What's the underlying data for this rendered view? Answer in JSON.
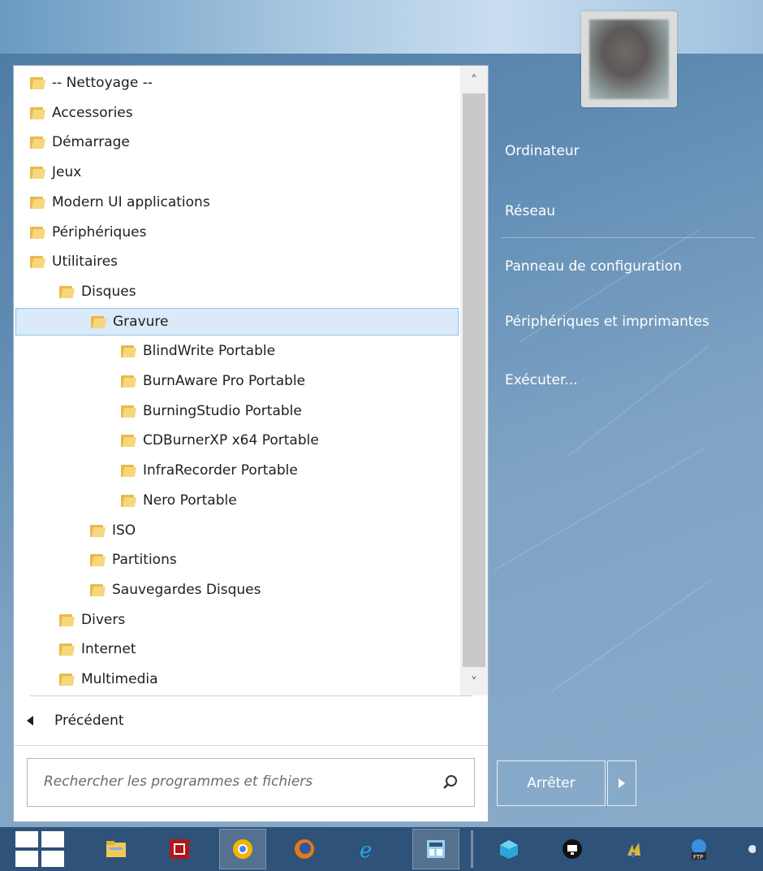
{
  "tree": {
    "items": [
      {
        "label": "-- Nettoyage --",
        "depth": 0
      },
      {
        "label": "Accessories",
        "depth": 0
      },
      {
        "label": "Démarrage",
        "depth": 0
      },
      {
        "label": "Jeux",
        "depth": 0
      },
      {
        "label": "Modern UI applications",
        "depth": 0
      },
      {
        "label": "Périphériques",
        "depth": 0
      },
      {
        "label": "Utilitaires",
        "depth": 0
      },
      {
        "label": "Disques",
        "depth": 1
      },
      {
        "label": "Gravure",
        "depth": 2,
        "selected": true
      },
      {
        "label": "BlindWrite Portable",
        "depth": 3
      },
      {
        "label": "BurnAware Pro Portable",
        "depth": 3
      },
      {
        "label": "BurningStudio Portable",
        "depth": 3
      },
      {
        "label": "CDBurnerXP x64 Portable",
        "depth": 3
      },
      {
        "label": "InfraRecorder Portable",
        "depth": 3
      },
      {
        "label": "Nero Portable",
        "depth": 3
      },
      {
        "label": "ISO",
        "depth": 2
      },
      {
        "label": "Partitions",
        "depth": 2
      },
      {
        "label": "Sauvegardes Disques",
        "depth": 2
      },
      {
        "label": "Divers",
        "depth": 1
      },
      {
        "label": "Internet",
        "depth": 1
      },
      {
        "label": "Multimedia",
        "depth": 1
      }
    ]
  },
  "nav": {
    "back_label": "Précédent"
  },
  "search": {
    "placeholder": "Rechercher les programmes et fichiers"
  },
  "right": {
    "computer": "Ordinateur",
    "network": "Réseau",
    "control_panel": "Panneau de configuration",
    "devices": "Périphériques et imprimantes",
    "run": "Exécuter..."
  },
  "shutdown": {
    "label": "Arrêter"
  },
  "colors": {
    "folder": "#e9b94a",
    "selection": "#dbeaf9",
    "taskbar": "#2f5278"
  },
  "taskbar": {
    "icons": [
      "start-icon",
      "file-explorer-icon",
      "filezilla-like-icon",
      "chrome-icon",
      "firefox-icon",
      "internet-explorer-icon",
      "calculator-icon",
      "box-3d-icon",
      "monitor-icon",
      "tool-icon",
      "ftp-icon"
    ]
  }
}
